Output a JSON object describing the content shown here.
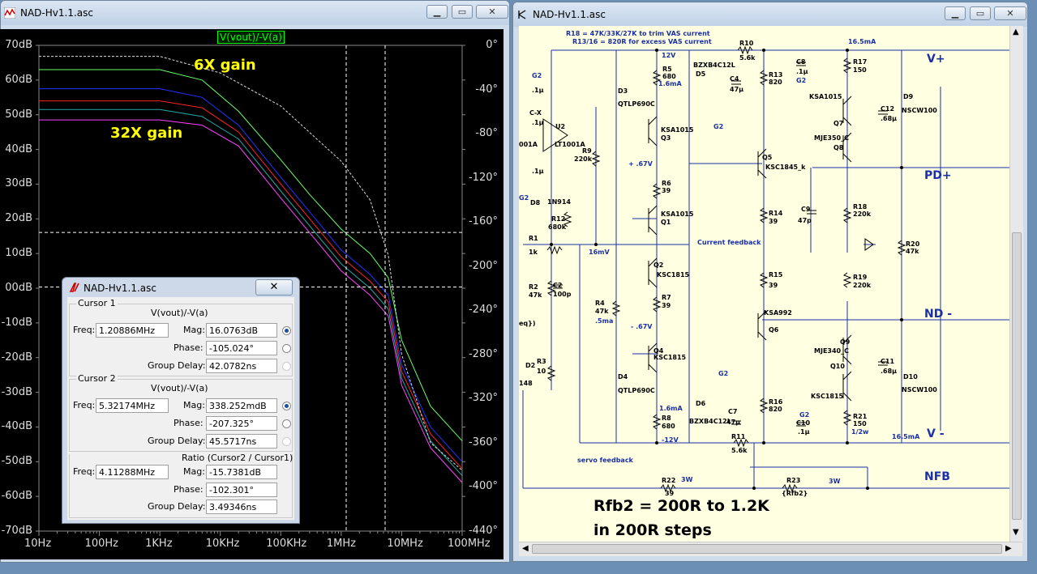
{
  "plot_window": {
    "title": "NAD-Hv1.1.asc",
    "trace_label": "V(vout)/-V(a)",
    "annotations": {
      "gain_6x": "6X gain",
      "gain_32x": "32X gain"
    },
    "colors": {
      "trace": "#00ff00",
      "background": "#000000",
      "cursor": "#ffffff"
    }
  },
  "chart_data": {
    "type": "line",
    "title": "V(vout)/-V(a)",
    "x_ticks": [
      "10Hz",
      "100Hz",
      "1KHz",
      "10KHz",
      "100KHz",
      "1MHz",
      "10MHz",
      "100MHz"
    ],
    "y_ticks": [
      "70dB",
      "60dB",
      "50dB",
      "40dB",
      "30dB",
      "20dB",
      "10dB",
      "00dB",
      "-10dB",
      "-20dB",
      "-30dB",
      "-40dB",
      "-50dB",
      "-60dB",
      "-70dB"
    ],
    "phase_ticks": [
      "0°",
      "-40°",
      "-80°",
      "-120°",
      "-160°",
      "-200°",
      "-240°",
      "-280°",
      "-320°",
      "-360°",
      "-400°",
      "-440°"
    ],
    "xlim": [
      10,
      100000000
    ],
    "ylim": [
      -70,
      70
    ],
    "phase_lim": [
      -440,
      0
    ],
    "x_scale": "log",
    "grid": false,
    "series": [
      {
        "color": "#66ff66",
        "x": [
          10,
          1000,
          5000,
          20000,
          100000,
          300000,
          1000000,
          3000000,
          6000000,
          10000000,
          30000000,
          100000000
        ],
        "y": [
          63,
          63,
          60,
          51,
          37,
          27,
          17,
          10,
          3,
          -15,
          -34,
          -44
        ]
      },
      {
        "color": "#2233ff",
        "x": [
          10,
          1000,
          5000,
          20000,
          100000,
          300000,
          1000000,
          3000000,
          6000000,
          10000000,
          30000000,
          100000000
        ],
        "y": [
          57.5,
          57.5,
          55,
          47,
          32,
          22,
          11,
          4,
          -2,
          -22,
          -40,
          -50
        ]
      },
      {
        "color": "#ff2222",
        "x": [
          10,
          1000,
          5000,
          20000,
          100000,
          300000,
          1000000,
          3000000,
          6000000,
          10000000,
          30000000,
          100000000
        ],
        "y": [
          54,
          54,
          52,
          45,
          30,
          20,
          9,
          2,
          -4,
          -24,
          -42,
          -52
        ]
      },
      {
        "color": "#22aaaa",
        "x": [
          10,
          1000,
          5000,
          20000,
          100000,
          300000,
          1000000,
          3000000,
          6000000,
          10000000,
          30000000,
          100000000
        ],
        "y": [
          51.5,
          51.5,
          49.5,
          43,
          28,
          18,
          7,
          0,
          -6,
          -26,
          -44,
          -54
        ]
      },
      {
        "color": "#ff44ff",
        "x": [
          10,
          1000,
          5000,
          20000,
          100000,
          300000,
          1000000,
          3000000,
          6000000,
          10000000,
          30000000,
          100000000
        ],
        "y": [
          48.5,
          48.5,
          47,
          41,
          26,
          16,
          5,
          -2,
          -8,
          -28,
          -46,
          -56
        ]
      }
    ],
    "phase_series": {
      "color": "#dddddd",
      "x": [
        10,
        1000,
        10000,
        100000,
        1000000,
        3000000,
        6000000,
        10000000,
        30000000,
        100000000
      ],
      "y": [
        -10,
        -10,
        -25,
        -55,
        -105,
        -140,
        -190,
        -280,
        -360,
        -385
      ]
    },
    "cursors": [
      {
        "x": 1208860,
        "y": 16.0763
      },
      {
        "x": 5321740,
        "y": 0.338252
      }
    ]
  },
  "cursor_dialog": {
    "title": "NAD-Hv1.1.asc",
    "close_label": "✕",
    "cursor1": {
      "group": "Cursor 1",
      "expr": "V(vout)/-V(a)",
      "freq_label": "Freq:",
      "freq": "1.20886MHz",
      "mag_label": "Mag:",
      "mag": "16.0763dB",
      "phase_label": "Phase:",
      "phase": "-105.024°",
      "gd_label": "Group Delay:",
      "gd": "42.0782ns"
    },
    "cursor2": {
      "group": "Cursor 2",
      "expr": "V(vout)/-V(a)",
      "freq_label": "Freq:",
      "freq": "5.32174MHz",
      "mag_label": "Mag:",
      "mag": "338.252mdB",
      "phase_label": "Phase:",
      "phase": "-207.325°",
      "gd_label": "Group Delay:",
      "gd": "45.5717ns"
    },
    "ratio": {
      "group": "Ratio (Cursor2 / Cursor1)",
      "freq_label": "Freq:",
      "freq": "4.11288MHz",
      "mag_label": "Mag:",
      "mag": "-15.7381dB",
      "phase_label": "Phase:",
      "phase": "-102.301°",
      "gd_label": "Group Delay:",
      "gd": "3.49346ns"
    }
  },
  "schematic_window": {
    "title": "NAD-Hv1.1.asc",
    "notes": {
      "n1": "R18 = 47K/33K/27K to trim VAS current",
      "n2": "R13/16 = 820R for excess VAS current"
    },
    "nets": {
      "vplus": "V+",
      "pdplus": "PD+",
      "ndminus": "ND -",
      "vminus": "V -",
      "nfb": "NFB"
    },
    "big_text": {
      "line1": "Rfb2 = 200R to 1.2K",
      "line2": "in 200R steps"
    },
    "labels": {
      "r10": "R10",
      "r10v": "5.6k",
      "i165a": "16.5mA",
      "v12": "12V",
      "r5": "R5",
      "r5v": "680",
      "ma16": "1.6mA",
      "bzx": "BZXB4C12L",
      "d5": "D5",
      "c4": "C4",
      "c4v": "47µ",
      "g2a": "G2",
      "r13": "R13",
      "r13v": "820",
      "c8": "C8",
      "c8v": ".1µ",
      "g2b": "G2",
      "r17": "R17",
      "r17v": "150",
      "ksa1015a": "KSA1015",
      "q7": "Q7",
      "c12": "C12",
      "c12v": ".68µ",
      "d9": "D9",
      "nscw": "NSCW100",
      "mje350": "MJE350_C",
      "q8": "Q8",
      "g2c": "G2",
      "c1": ".1µ",
      "cx": "C-X",
      "cxv": ".1µ",
      "u2": "U2",
      "lt1001": "LT1001A",
      "lt1001b": "001A",
      "d3": "D3",
      "qtlp": "QTLP690C",
      "ksa1015b": "KSA1015",
      "q3": "Q3",
      "r9": "R9",
      "r9v": "220k",
      "q5": "Q5",
      "ksc1845": "KSC1845_k",
      "v67p": "+ .67V",
      "r6": "R6",
      "r6v": "39",
      "c2v": ".1µ",
      "g2d": "G2",
      "d8": "D8",
      "in914": "1N914",
      "r12": "R12",
      "r12v": "680k",
      "r14": "R14",
      "r14v": "39",
      "c9": "C9",
      "c9v": "47p",
      "r18": "R18",
      "r18v": "220k",
      "ksa1015c": "KSA1015",
      "q1": "Q1",
      "cf": "Current feedback",
      "r1": "R1",
      "r1v": "1k",
      "mv16": "16mV",
      "r20": "R20",
      "r20v": "47k",
      "q2": "Q2",
      "ksc1815a": "KSC1815",
      "r15": "R15",
      "r15v": "39",
      "r19": "R19",
      "r19v": "220k",
      "r2": "R2",
      "r2v": "47k",
      "c2": "C2",
      "c2b": "100p",
      "r7": "R7",
      "r7v": "39",
      "r4": "R4",
      "r4v": "47k",
      "ma5": ".5ma",
      "ksa992": "KSA992",
      "q6": "Q6",
      "eq": "eq})",
      "v67n": "- .67V",
      "q9": "Q9",
      "mje340": "MJE340_C",
      "c11": "C11",
      "c11v": ".68µ",
      "q4": "Q4",
      "ksc1815b": "KSC1815",
      "r3": "R3",
      "r3v": "10",
      "d2": "D2",
      "d148": "148",
      "q10": "Q10",
      "g2e": "G2",
      "d4": "D4",
      "qtlp2": "QTLP690C",
      "ksc1815c": "KSC1815",
      "d10": "D10",
      "nscw2": "NSCW100",
      "ma16b": "1.6mA",
      "d6": "D6",
      "bzx2": "BZXB4C12L",
      "c7": "C7",
      "c7v": "47µ",
      "r16": "R16",
      "r16v": "820",
      "g2f": "G2",
      "c10": "C10",
      "c10v": ".1µ",
      "r21": "R21",
      "r21v": "150",
      "r8": "R8",
      "r8v": "680",
      "v12n": "-12V",
      "r11": "R11",
      "r11v": "5.6k",
      "w12": "1/2w",
      "i165b": "16.5mA",
      "servo": "servo feedback",
      "r22": "R22",
      "r22v": "39",
      "w3a": "3W",
      "r23": "R23",
      "r23v": "{Rfb2}",
      "w3b": "3W"
    }
  }
}
